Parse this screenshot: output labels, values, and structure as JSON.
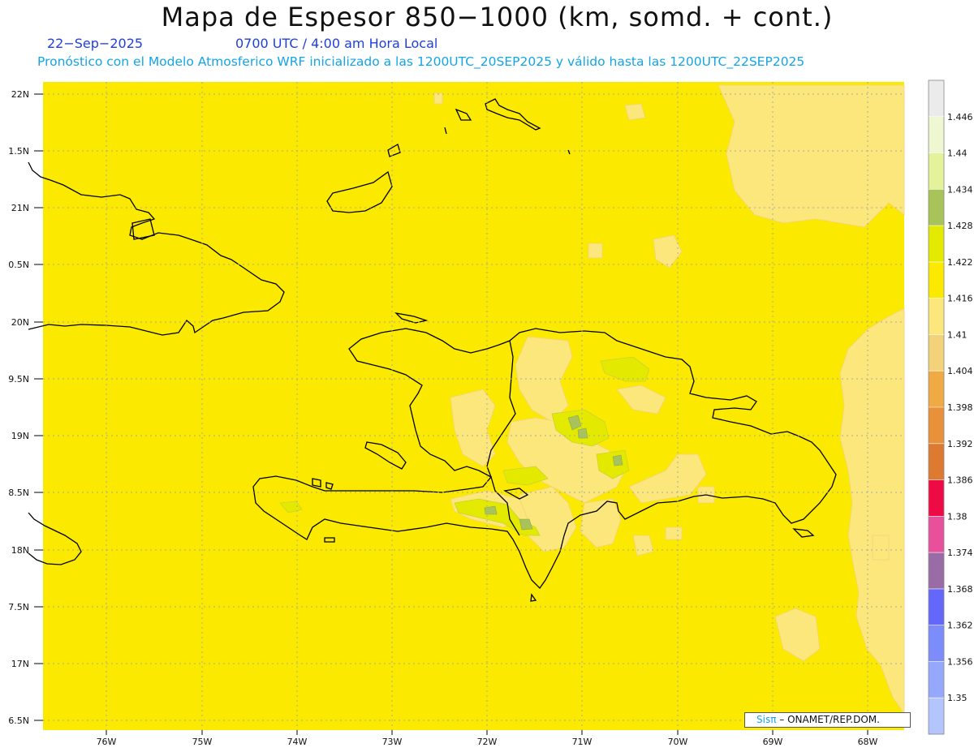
{
  "header": {
    "title": "Mapa de Espesor 850−1000 (km, somd. + cont.)",
    "date": "22−Sep−2025",
    "time": "0700 UTC / 4:00 am Hora Local",
    "description": "Pronóstico con el Modelo Atmosferico WRF inicializado a las 1200UTC_20SEP2025 y válido hasta las  1200UTC_22SEP2025"
  },
  "map": {
    "lat_labels": [
      "22N",
      "1.5N",
      "21N",
      "0.5N",
      "20N",
      "9.5N",
      "19N",
      "8.5N",
      "18N",
      "7.5N",
      "17N",
      "6.5N"
    ],
    "lon_labels": [
      "76W",
      "75W",
      "74W",
      "73W",
      "72W",
      "71W",
      "70W",
      "69W",
      "68W"
    ],
    "field_color": "#fbea00",
    "contour_colors": {
      "1.41": "#fce77c",
      "1.404": "#f4d27a",
      "1.422": "#e4e900",
      "1.428": "#a8c35a"
    }
  },
  "colorbar": {
    "labels": [
      "1.446",
      "1.44",
      "1.434",
      "1.428",
      "1.422",
      "1.416",
      "1.41",
      "1.404",
      "1.398",
      "1.392",
      "1.386",
      "1.38",
      "1.374",
      "1.368",
      "1.362",
      "1.356",
      "1.35"
    ],
    "colors": [
      "#ebebeb",
      "#eef6d2",
      "#e4f299",
      "#a8c35a",
      "#e4e900",
      "#fbea00",
      "#fce77c",
      "#f4d27a",
      "#efaa45",
      "#e8903a",
      "#dc7a32",
      "#ee0a45",
      "#e8509c",
      "#9a6ca6",
      "#6468fa",
      "#7c8cfb",
      "#96a8fc",
      "#b4c4fd"
    ]
  },
  "credit": {
    "brand": "Sisπ",
    "text": "– ONAMET/REP.DOM."
  }
}
